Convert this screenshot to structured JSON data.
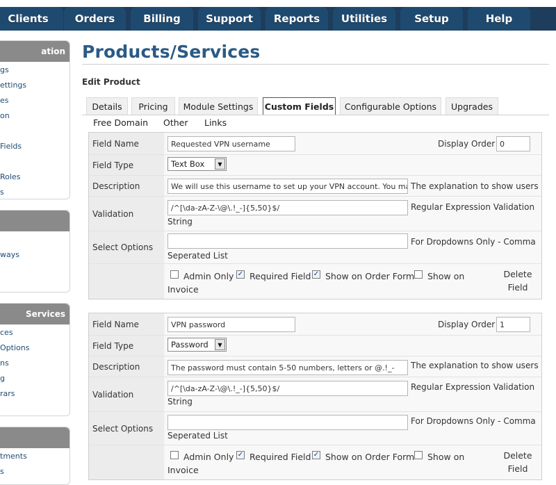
{
  "nav": {
    "tabs": [
      "Clients",
      "Orders",
      "Billing",
      "Support",
      "Reports",
      "Utilities",
      "Setup",
      "Help"
    ]
  },
  "sidebar": {
    "blocks": [
      {
        "title": "ation",
        "items": [
          "gs",
          "ettings",
          "es",
          "on",
          "Fields",
          "Roles",
          "s"
        ]
      },
      {
        "title": "",
        "items": [
          "ways"
        ]
      },
      {
        "title": "Services",
        "items": [
          "ces",
          "Options",
          "ns",
          "g",
          "rars"
        ]
      },
      {
        "title": "",
        "items": [
          "tments",
          "s"
        ]
      }
    ]
  },
  "page": {
    "title": "Products/Services",
    "subtitle": "Edit Product"
  },
  "tabs": {
    "row1": [
      "Details",
      "Pricing",
      "Module Settings",
      "Custom Fields",
      "Configurable Options",
      "Upgrades"
    ],
    "row2": [
      "Free Domain",
      "Other",
      "Links"
    ],
    "active": "Custom Fields"
  },
  "labels": {
    "field_name": "Field Name",
    "display_order": "Display Order",
    "field_type": "Field Type",
    "description": "Description",
    "validation": "Validation",
    "select_options": "Select Options",
    "desc_help": "The explanation to show users",
    "valid_help_1": "Regular Expression Validation",
    "valid_help_2": "String",
    "select_help_1": "For Dropdowns Only - Comma",
    "select_help_2": "Seperated List",
    "admin_only": "Admin Only",
    "required": "Required Field",
    "show_order": "Show on Order Form",
    "show_invoice_1": "Show on",
    "show_invoice_2": "Invoice",
    "delete_1": "Delete",
    "delete_2": "Field"
  },
  "fields": [
    {
      "name": "Requested VPN username",
      "display_order": "0",
      "type": "Text Box",
      "description": "We will use this username to set up your VPN account. You may",
      "validation": "/^[\\da-zA-Z-\\@\\.!_-]{5,50}$/",
      "select_options": "",
      "admin_only": false,
      "required": true,
      "show_order": true,
      "show_invoice": false
    },
    {
      "name": "VPN password",
      "display_order": "1",
      "type": "Password",
      "description": "The password must contain 5-50 numbers, letters or @.!_-",
      "validation": "/^[\\da-zA-Z-\\@\\.!_-]{5,50}$/",
      "select_options": "",
      "admin_only": false,
      "required": true,
      "show_order": true,
      "show_invoice": false
    }
  ],
  "check_mark": "✓",
  "dropdown_arrow": "▼"
}
